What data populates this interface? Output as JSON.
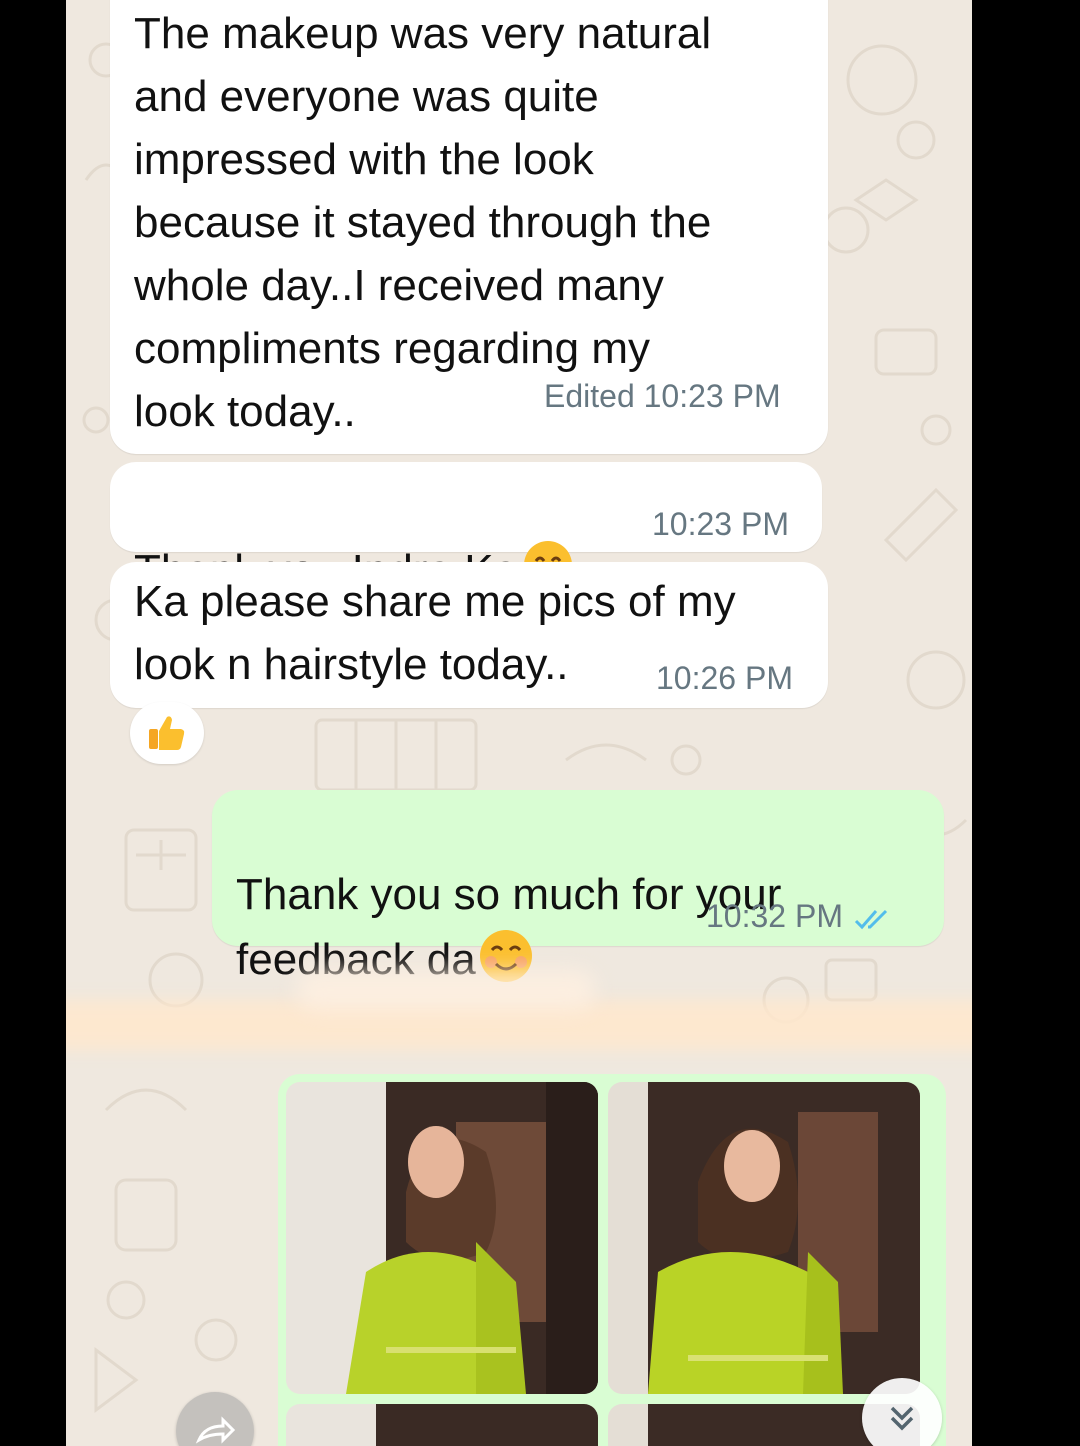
{
  "messages": [
    {
      "direction": "incoming",
      "text": "The makeup was very natural\nand everyone was quite\nimpressed with the look\nbecause it stayed through the\nwhole day..I received many\ncompliments regarding my\nlook today..",
      "edited_label": "Edited",
      "time": "10:23 PM"
    },
    {
      "direction": "incoming",
      "text": "Thank you Indra Ka",
      "emoji": "hugging-face",
      "time": "10:23 PM"
    },
    {
      "direction": "incoming",
      "text": "Ka please share me pics of my\nlook n hairstyle today..",
      "time": "10:26 PM",
      "reaction": "thumbs-up"
    },
    {
      "direction": "outgoing",
      "text": "Thank you so much for your\nfeedback da",
      "emoji": "smiling-face",
      "time": "10:32 PM",
      "status": "read",
      "status_color": "#53bdeb"
    }
  ],
  "album": {
    "direction": "outgoing",
    "photo_count_visible": 4
  },
  "controls": {
    "forward_icon": "forward-icon",
    "scroll_down_icon": "double-chevron-down-icon"
  },
  "colors": {
    "chat_bg": "#efe8df",
    "incoming_bubble": "#ffffff",
    "outgoing_bubble": "#d9fdd3",
    "meta_text": "#667781",
    "read_ticks": "#53bdeb"
  }
}
